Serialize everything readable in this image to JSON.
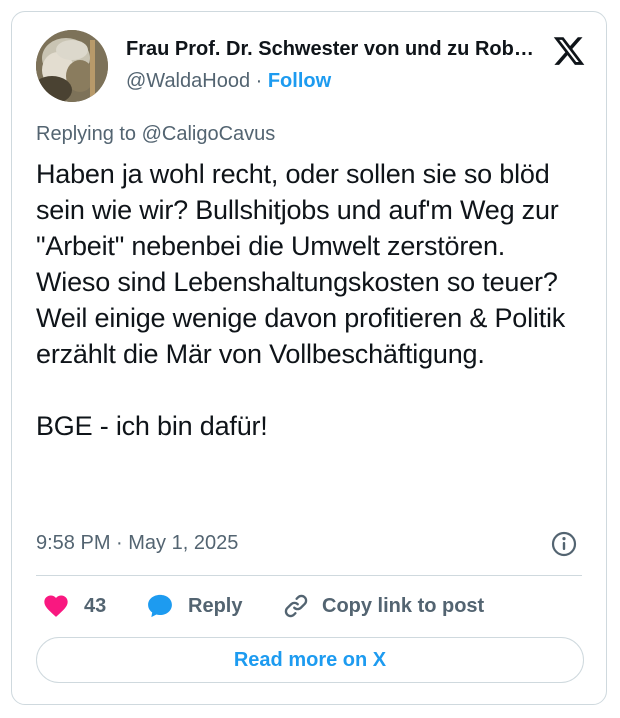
{
  "author": {
    "display_name": "Frau Prof. Dr. Schwester von und zu Rob…",
    "handle": "@WaldaHood",
    "separator": " · ",
    "follow_label": "Follow"
  },
  "reply_context": "Replying to @CaligoCavus",
  "tweet_text": "Haben ja wohl recht, oder sollen sie so blöd sein wie wir? Bullshitjobs und auf'm Weg zur \"Arbeit\" nebenbei die Umwelt zerstören.\nWieso sind Lebenshaltungskosten so teuer? Weil einige wenige davon profitieren & Politik erzählt die Mär von Vollbeschäftigung.\n\nBGE - ich bin dafür!",
  "timestamp": "9:58 PM · May 1, 2025",
  "actions": {
    "like_count": "43",
    "reply_label": "Reply",
    "copy_label": "Copy link to post"
  },
  "read_more_label": "Read more on X",
  "icons": {
    "logo": "x-logo-icon",
    "info": "info-icon",
    "like": "heart-icon",
    "reply": "speech-bubble-icon",
    "copy": "link-icon"
  },
  "colors": {
    "accent": "#1d9bf0",
    "like": "#f91880",
    "text": "#0f1419",
    "muted": "#536471",
    "border": "#cfd9de"
  }
}
